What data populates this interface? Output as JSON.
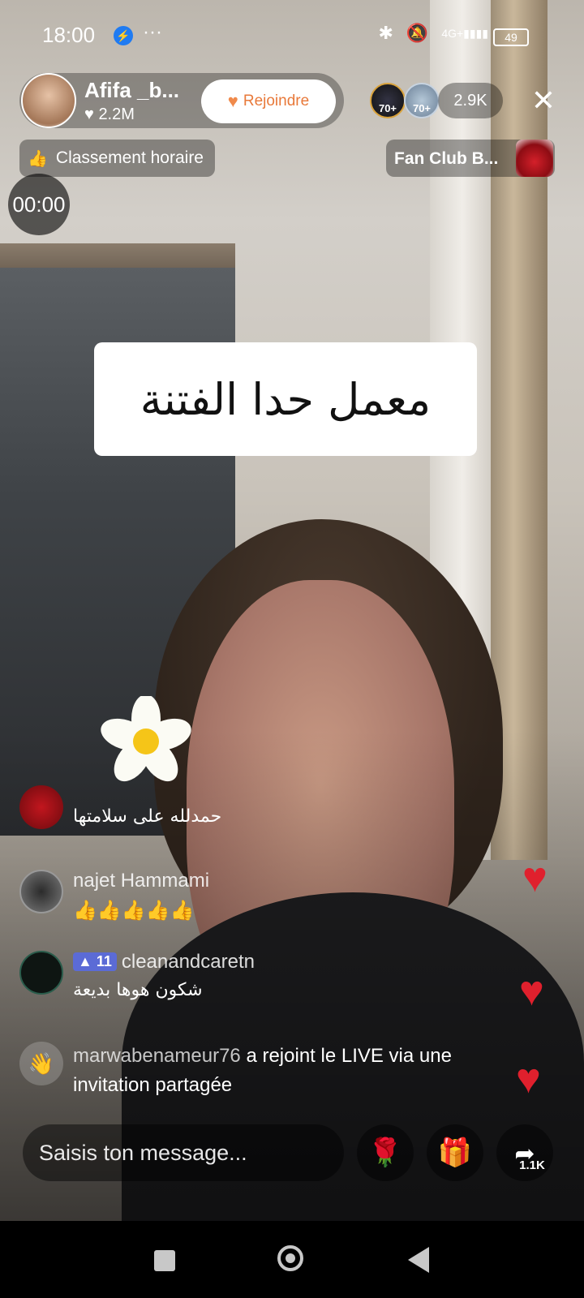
{
  "status_bar": {
    "time": "18:00",
    "more": "···",
    "network": "4G+",
    "battery": "49",
    "icons": [
      "messenger-icon",
      "bluetooth-icon",
      "mute-icon",
      "signal-icon",
      "battery-icon"
    ]
  },
  "host": {
    "name": "Afifa _b...",
    "likes": "2.2M",
    "join_label": "Rejoindre"
  },
  "viewers": {
    "top1_level": "70+",
    "top2_level": "70+",
    "count": "2.9K"
  },
  "ranking": {
    "label": "Classement horaire"
  },
  "fan_club": {
    "label": "Fan Club B..."
  },
  "timer": "00:00",
  "sticker_text": "معمل حدا الفتنة",
  "comments": [
    {
      "user": "",
      "text": "حمدلله على سلامتها"
    },
    {
      "user": "najet Hammami",
      "text": "👍👍👍👍👍"
    },
    {
      "user": "cleanandcaretn",
      "badge": "11",
      "text": "شكون هوها بديعة"
    }
  ],
  "join_notice": {
    "user": "marwabenameur76",
    "line1": " a rejoint le LIVE via une",
    "line2": "invitation partagée"
  },
  "input": {
    "placeholder": "Saisis ton message..."
  },
  "actions": {
    "share_count": "1.1K"
  },
  "colors": {
    "heart": "#e0202d",
    "join_accent": "#e8793a",
    "badge": "#5b6bd6"
  }
}
